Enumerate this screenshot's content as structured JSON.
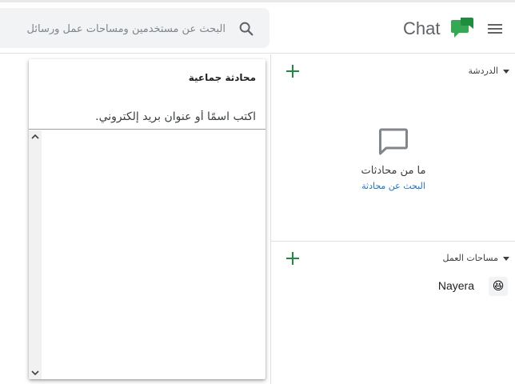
{
  "header": {
    "app_title": "Chat",
    "search": {
      "placeholder": "البحث عن مستخدمين ومساحات عمل ورسائل"
    }
  },
  "sections": {
    "chats": {
      "title": "الدردشة",
      "empty_text": "ما من محادثات",
      "find_link": "البحث عن محادثة"
    },
    "spaces": {
      "title": "مساحات العمل",
      "items": [
        {
          "name": "Nayera",
          "avatar": "😆"
        }
      ]
    }
  },
  "dialog": {
    "title": "محادثة جماعية",
    "input_placeholder": "اكتب اسمًا أو عنوان بريد إلكتروني."
  },
  "icons": {
    "menu": "hamburger-menu-icon",
    "logo": "google-chat-logo-icon",
    "search": "search-icon",
    "add": "plus-icon",
    "empty": "chat-bubble-icon",
    "caret": "caret-down-icon"
  },
  "colors": {
    "accent_green": "#1e8e3e",
    "logo_green": "#34a853",
    "link_blue": "#1a73e8",
    "search_bg": "#f1f3f4"
  }
}
